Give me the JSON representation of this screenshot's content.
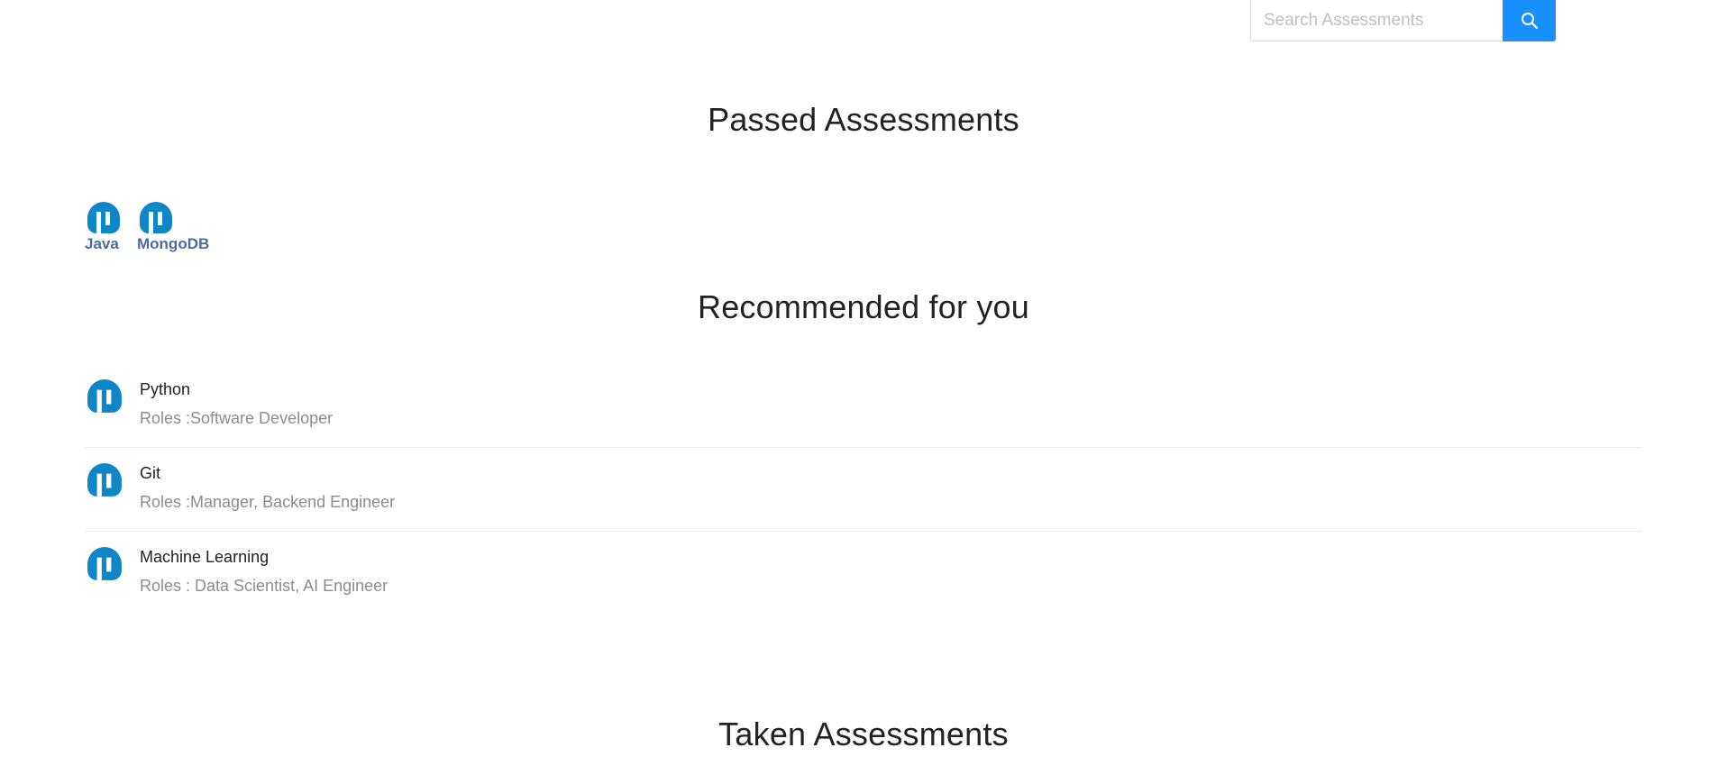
{
  "search": {
    "placeholder": "Search Assessments",
    "value": "",
    "button_icon": "search-icon"
  },
  "passed": {
    "title": "Passed Assessments",
    "items": [
      {
        "label": "Java",
        "icon": "assessment-logo-icon"
      },
      {
        "label": "MongoDB",
        "icon": "assessment-logo-icon"
      }
    ]
  },
  "recommended": {
    "title": "Recommended for you",
    "items": [
      {
        "name": "Python",
        "roles": "Roles :Software Developer",
        "icon": "assessment-logo-icon"
      },
      {
        "name": "Git",
        "roles": "Roles :Manager, Backend Engineer",
        "icon": "assessment-logo-icon"
      },
      {
        "name": "Machine Learning",
        "roles": "Roles : Data Scientist, AI Engineer",
        "icon": "assessment-logo-icon"
      }
    ]
  },
  "taken": {
    "title": "Taken Assessments"
  },
  "colors": {
    "accent": "#1890ff",
    "logo": "#0e86c8",
    "passed_label": "#4a6aa8",
    "roles_text": "#8c8c8c",
    "divider": "#ececec"
  }
}
